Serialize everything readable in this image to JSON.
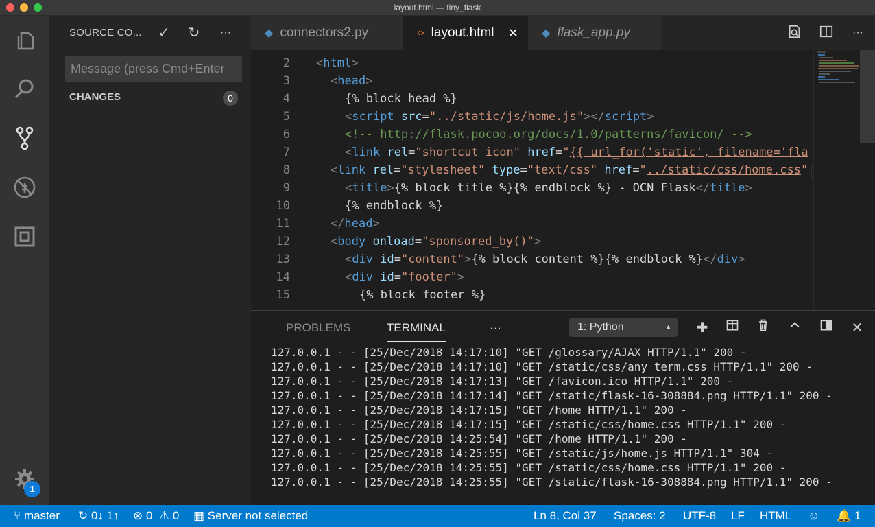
{
  "window": {
    "title": "layout.html — tiny_flask"
  },
  "sidebar": {
    "title": "SOURCE CO...",
    "commit_icon": "✓",
    "refresh_icon": "↻",
    "more_icon": "···",
    "message_placeholder": "Message (press Cmd+Enter",
    "changes_label": "CHANGES",
    "changes_count": "0"
  },
  "activity": {
    "settings_badge": "1"
  },
  "tabs": [
    {
      "label": "connectors2.py",
      "icon": "python-icon",
      "active": false
    },
    {
      "label": "layout.html",
      "icon": "html-icon",
      "active": true,
      "close": "✕"
    },
    {
      "label": "flask_app.py",
      "icon": "python-icon",
      "active": false
    }
  ],
  "editor": {
    "lines": [
      {
        "num": "2",
        "html": "<span class=\"pu\">&lt;</span><span class=\"tg\">html</span><span class=\"pu\">&gt;</span>",
        "indent": 0
      },
      {
        "num": "3",
        "html": "<span class=\"pu\">&lt;</span><span class=\"tg\">head</span><span class=\"pu\">&gt;</span>",
        "indent": 1
      },
      {
        "num": "4",
        "html": "<span class=\"tx\">{% block head %}</span>",
        "indent": 2
      },
      {
        "num": "5",
        "html": "<span class=\"pu\">&lt;</span><span class=\"tg\">script</span> <span class=\"at\">src</span><span class=\"tx\">=</span><span class=\"st\">\"<span class=\"ul\">../static/js/home.js</span>\"</span><span class=\"pu\">&gt;&lt;/</span><span class=\"tg\">script</span><span class=\"pu\">&gt;</span>",
        "indent": 2
      },
      {
        "num": "6",
        "html": "<span class=\"cm\">&lt;!-- <span class=\"ul\">http://flask.pocoo.org/docs/1.0/patterns/favicon/</span> --&gt;</span>",
        "indent": 2
      },
      {
        "num": "7",
        "html": "<span class=\"pu\">&lt;</span><span class=\"tg\">link</span> <span class=\"at\">rel</span><span class=\"tx\">=</span><span class=\"st\">\"shortcut icon\"</span> <span class=\"at\">href</span><span class=\"tx\">=</span><span class=\"st\">\"<span class=\"ul\">{{ url_for('static', filename='fla</span></span>",
        "indent": 2
      },
      {
        "num": "8",
        "html": "<span class=\"pu\">&lt;</span><span class=\"tg\">link</span> <span class=\"at\">rel</span><span class=\"tx\">=</span><span class=\"st\">\"stylesheet\"</span> <span class=\"at\">type</span><span class=\"tx\">=</span><span class=\"st\">\"text/css\"</span> <span class=\"at\">href</span><span class=\"tx\">=</span><span class=\"st\">\"<span class=\"ul\">../static/css/home.css</span>\"</span>",
        "indent": 1
      },
      {
        "num": "9",
        "html": "<span class=\"pu\">&lt;</span><span class=\"tg\">title</span><span class=\"pu\">&gt;</span><span class=\"tx\">{% block title %}{% endblock %} - OCN Flask</span><span class=\"pu\">&lt;/</span><span class=\"tg\">title</span><span class=\"pu\">&gt;</span>",
        "indent": 2
      },
      {
        "num": "10",
        "html": "<span class=\"tx\">{% endblock %}</span>",
        "indent": 2
      },
      {
        "num": "11",
        "html": "<span class=\"pu\">&lt;/</span><span class=\"tg\">head</span><span class=\"pu\">&gt;</span>",
        "indent": 1
      },
      {
        "num": "12",
        "html": "<span class=\"pu\">&lt;</span><span class=\"tg\">body</span> <span class=\"at\">onload</span><span class=\"tx\">=</span><span class=\"st\">\"sponsored_by()\"</span><span class=\"pu\">&gt;</span>",
        "indent": 1
      },
      {
        "num": "13",
        "html": "<span class=\"pu\">&lt;</span><span class=\"tg\">div</span> <span class=\"at\">id</span><span class=\"tx\">=</span><span class=\"st\">\"content\"</span><span class=\"pu\">&gt;</span><span class=\"tx\">{% block content %}{% endblock %}</span><span class=\"pu\">&lt;/</span><span class=\"tg\">div</span><span class=\"pu\">&gt;</span>",
        "indent": 2
      },
      {
        "num": "14",
        "html": "<span class=\"pu\">&lt;</span><span class=\"tg\">div</span> <span class=\"at\">id</span><span class=\"tx\">=</span><span class=\"st\">\"footer\"</span><span class=\"pu\">&gt;</span>",
        "indent": 2
      },
      {
        "num": "15",
        "html": "<span class=\"tx\">{% block footer %}</span>",
        "indent": 3
      }
    ]
  },
  "panel": {
    "tabs": [
      "PROBLEMS",
      "TERMINAL"
    ],
    "more": "···",
    "terminal_select": "1: Python",
    "terminal_lines": [
      "127.0.0.1 - - [25/Dec/2018 14:17:10] \"GET /glossary/AJAX HTTP/1.1\" 200 -",
      "127.0.0.1 - - [25/Dec/2018 14:17:10] \"GET /static/css/any_term.css HTTP/1.1\" 200 -",
      "127.0.0.1 - - [25/Dec/2018 14:17:13] \"GET /favicon.ico HTTP/1.1\" 200 -",
      "127.0.0.1 - - [25/Dec/2018 14:17:14] \"GET /static/flask-16-308884.png HTTP/1.1\" 200 -",
      "127.0.0.1 - - [25/Dec/2018 14:17:15] \"GET /home HTTP/1.1\" 200 -",
      "127.0.0.1 - - [25/Dec/2018 14:17:15] \"GET /static/css/home.css HTTP/1.1\" 200 -",
      "127.0.0.1 - - [25/Dec/2018 14:25:54] \"GET /home HTTP/1.1\" 200 -",
      "127.0.0.1 - - [25/Dec/2018 14:25:55] \"GET /static/js/home.js HTTP/1.1\" 304 -",
      "127.0.0.1 - - [25/Dec/2018 14:25:55] \"GET /static/css/home.css HTTP/1.1\" 200 -",
      "127.0.0.1 - - [25/Dec/2018 14:25:55] \"GET /static/flask-16-308884.png HTTP/1.1\" 200 -"
    ]
  },
  "status": {
    "branch": "master",
    "sync": "0↓ 1↑",
    "errors": "0",
    "warnings": "0",
    "server": "Server not selected",
    "position": "Ln 8, Col 37",
    "spaces": "Spaces: 2",
    "encoding": "UTF-8",
    "eol": "LF",
    "language": "HTML",
    "notifications": "1"
  },
  "colors": {
    "accent": "#007acc",
    "tag": "#569cd6",
    "attr": "#9cdcfe",
    "string": "#ce9178",
    "comment": "#6a9955"
  }
}
